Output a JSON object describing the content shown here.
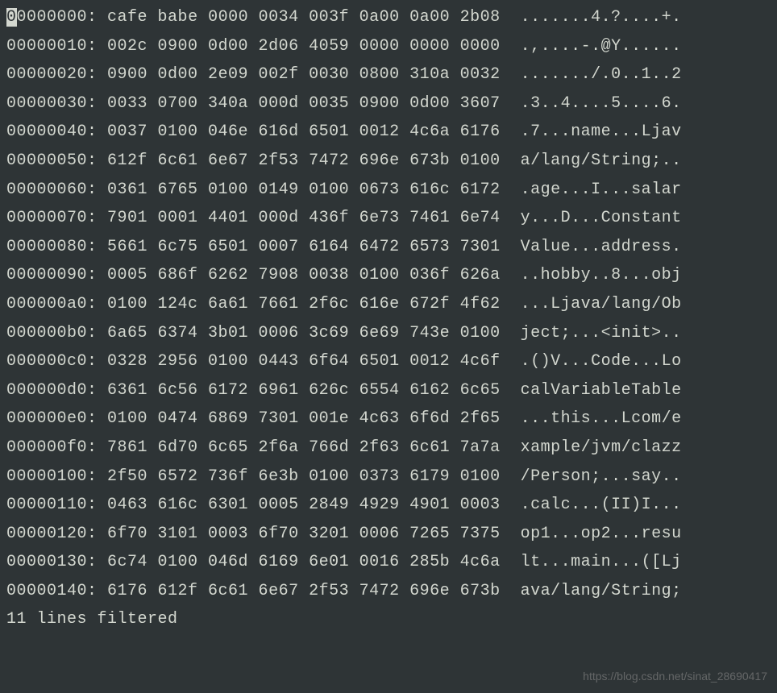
{
  "cursor_char": "0",
  "rows": [
    {
      "offset": "0000000",
      "hex": "cafe babe 0000 0034 003f 0a00 0a00 2b08",
      "ascii": ".......4.?....+."
    },
    {
      "offset": "00000010",
      "hex": "002c 0900 0d00 2d06 4059 0000 0000 0000",
      "ascii": ".,....-.@Y......"
    },
    {
      "offset": "00000020",
      "hex": "0900 0d00 2e09 002f 0030 0800 310a 0032",
      "ascii": "......./.0..1..2"
    },
    {
      "offset": "00000030",
      "hex": "0033 0700 340a 000d 0035 0900 0d00 3607",
      "ascii": ".3..4....5....6."
    },
    {
      "offset": "00000040",
      "hex": "0037 0100 046e 616d 6501 0012 4c6a 6176",
      "ascii": ".7...name...Ljav"
    },
    {
      "offset": "00000050",
      "hex": "612f 6c61 6e67 2f53 7472 696e 673b 0100",
      "ascii": "a/lang/String;.."
    },
    {
      "offset": "00000060",
      "hex": "0361 6765 0100 0149 0100 0673 616c 6172",
      "ascii": ".age...I...salar"
    },
    {
      "offset": "00000070",
      "hex": "7901 0001 4401 000d 436f 6e73 7461 6e74",
      "ascii": "y...D...Constant"
    },
    {
      "offset": "00000080",
      "hex": "5661 6c75 6501 0007 6164 6472 6573 7301",
      "ascii": "Value...address."
    },
    {
      "offset": "00000090",
      "hex": "0005 686f 6262 7908 0038 0100 036f 626a",
      "ascii": "..hobby..8...obj"
    },
    {
      "offset": "000000a0",
      "hex": "0100 124c 6a61 7661 2f6c 616e 672f 4f62",
      "ascii": "...Ljava/lang/Ob"
    },
    {
      "offset": "000000b0",
      "hex": "6a65 6374 3b01 0006 3c69 6e69 743e 0100",
      "ascii": "ject;...<init>.."
    },
    {
      "offset": "000000c0",
      "hex": "0328 2956 0100 0443 6f64 6501 0012 4c6f",
      "ascii": ".()V...Code...Lo"
    },
    {
      "offset": "000000d0",
      "hex": "6361 6c56 6172 6961 626c 6554 6162 6c65",
      "ascii": "calVariableTable"
    },
    {
      "offset": "000000e0",
      "hex": "0100 0474 6869 7301 001e 4c63 6f6d 2f65",
      "ascii": "...this...Lcom/e"
    },
    {
      "offset": "000000f0",
      "hex": "7861 6d70 6c65 2f6a 766d 2f63 6c61 7a7a",
      "ascii": "xample/jvm/clazz"
    },
    {
      "offset": "00000100",
      "hex": "2f50 6572 736f 6e3b 0100 0373 6179 0100",
      "ascii": "/Person;...say.."
    },
    {
      "offset": "00000110",
      "hex": "0463 616c 6301 0005 2849 4929 4901 0003",
      "ascii": ".calc...(II)I..."
    },
    {
      "offset": "00000120",
      "hex": "6f70 3101 0003 6f70 3201 0006 7265 7375",
      "ascii": "op1...op2...resu"
    },
    {
      "offset": "00000130",
      "hex": "6c74 0100 046d 6169 6e01 0016 285b 4c6a",
      "ascii": "lt...main...([Lj"
    },
    {
      "offset": "00000140",
      "hex": "6176 612f 6c61 6e67 2f53 7472 696e 673b",
      "ascii": "ava/lang/String;"
    }
  ],
  "status": "11 lines filtered",
  "watermark": "https://blog.csdn.net/sinat_28690417"
}
